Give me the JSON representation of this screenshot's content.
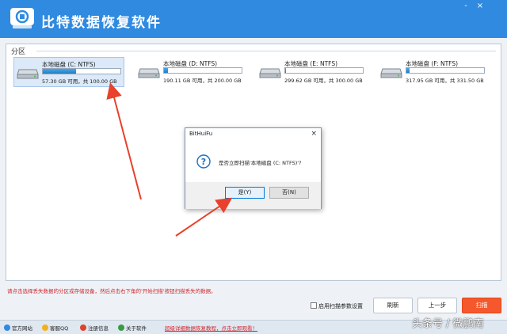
{
  "app": {
    "title": "比特数据恢复软件"
  },
  "window_controls": [
    "-",
    "×"
  ],
  "section": {
    "label": "分区"
  },
  "disks": [
    {
      "name": "本地磁盘 (C: NTFS)",
      "info": "57.30 GB 可用，共 100.00 GB",
      "used_fraction": 0.43,
      "selected": true
    },
    {
      "name": "本地磁盘 (D: NTFS)",
      "info": "190.11 GB 可用，共 200.00 GB",
      "used_fraction": 0.05,
      "selected": false
    },
    {
      "name": "本地磁盘 (E: NTFS)",
      "info": "299.62 GB 可用，共 300.00 GB",
      "used_fraction": 0.01,
      "selected": false
    },
    {
      "name": "本地磁盘 (F: NTFS)",
      "info": "317.95 GB 可用，共 331.50 GB",
      "used_fraction": 0.04,
      "selected": false
    }
  ],
  "dialog": {
    "title": "BitHuiFu",
    "close": "×",
    "message": "是否立即扫描'本地磁盘 (C: NTFS)'?",
    "yes_label": "是(Y)",
    "no_label": "否(N)"
  },
  "hint": "请点击选择丢失数据的分区或存储设备，然后点击右下角的'开始扫描'按钮扫描丢失的数据。",
  "options": {
    "scan_params_label": "启用扫描参数设置"
  },
  "buttons": {
    "refresh": "刷新",
    "prev": "上一步",
    "scan": "扫描"
  },
  "footer": {
    "official_site": "官方网站",
    "support_qq": "客服QQ",
    "register": "注册信息",
    "about": "关于软件",
    "tutorial_link": "超级详细数据恢复教程，点击立即观看！"
  },
  "watermark": "头条号 / 微鹏南",
  "colors": {
    "titlebar": "#2f8ae0",
    "accent": "#f5582c",
    "hint": "#d0262d",
    "arrow": "#e8412c"
  }
}
